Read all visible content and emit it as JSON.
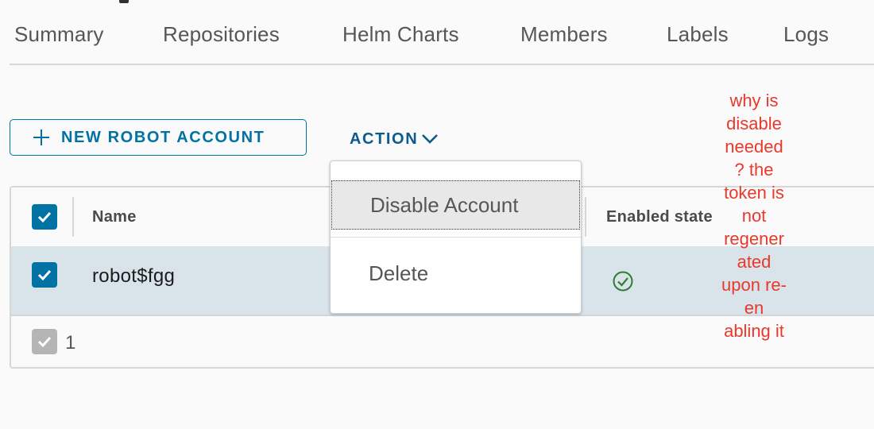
{
  "tabs": [
    {
      "label": "Summary"
    },
    {
      "label": "Repositories"
    },
    {
      "label": "Helm Charts"
    },
    {
      "label": "Members"
    },
    {
      "label": "Labels"
    },
    {
      "label": "Logs"
    }
  ],
  "toolbar": {
    "new_robot_label": "NEW ROBOT ACCOUNT",
    "action_label": "ACTION"
  },
  "grid": {
    "columns": [
      "Name",
      "Enabled state"
    ],
    "rows": [
      {
        "name": "robot$fgg",
        "enabled": true,
        "selected": true
      }
    ],
    "header_selected": true,
    "footer_count": "1"
  },
  "action_menu": {
    "items": [
      {
        "label": "Disable Account"
      },
      {
        "label": "Delete"
      }
    ]
  },
  "annotation": {
    "text": "why is\ndisable\nneeded\n? the\ntoken is\nnot\nregener\nated\nupon re-\nen\nabling it",
    "color": "#e8392c"
  },
  "colors": {
    "accent": "#0072a3",
    "row_selected": "#d9e4ea",
    "success": "#2e7d32"
  }
}
